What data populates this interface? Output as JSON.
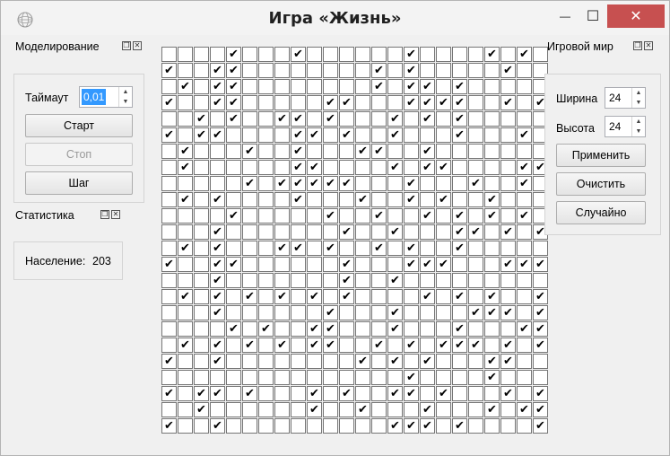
{
  "window": {
    "title": "Игра «Жизнь»",
    "icon": "sphere-icon",
    "minimize": "—",
    "maximize": "☐",
    "close": "✕"
  },
  "modeling": {
    "title": "Моделирование",
    "timeout_label": "Таймаут",
    "timeout_value": "0,01",
    "start": "Старт",
    "stop": "Стоп",
    "step": "Шаг"
  },
  "stats": {
    "title": "Статистика",
    "population_label": "Население:",
    "population_value": "203"
  },
  "world": {
    "title": "Игровой мир",
    "width_label": "Ширина",
    "width_value": "24",
    "height_label": "Высота",
    "height_value": "24",
    "apply": "Применить",
    "clear": "Очистить",
    "random": "Случайно"
  },
  "board": {
    "columns": 24,
    "check_glyph": "✔",
    "rows": [
      "000010001000000100001010",
      "100110000000010100000100",
      "010110000000010110100000",
      "100110000011000111100101",
      "001010011010001010100000",
      "101100001101001000100010",
      "010001001000110010000000",
      "010000001100001011000011",
      "000001011111000100010010",
      "010100001000100101001000",
      "000010000010010010101010",
      "000100000001001000110101",
      "010100011010010100100000",
      "100110000001000111000111",
      "000100000001001000000000",
      "010101010101000010101001",
      "000100000010001000011101",
      "000010100110001000100011",
      "010101010110010101110101",
      "100100000000101010001100",
      "000000000000000100001000",
      "101101000101001101000101",
      "001000000100100010001011",
      "100100000000001110100001"
    ]
  }
}
